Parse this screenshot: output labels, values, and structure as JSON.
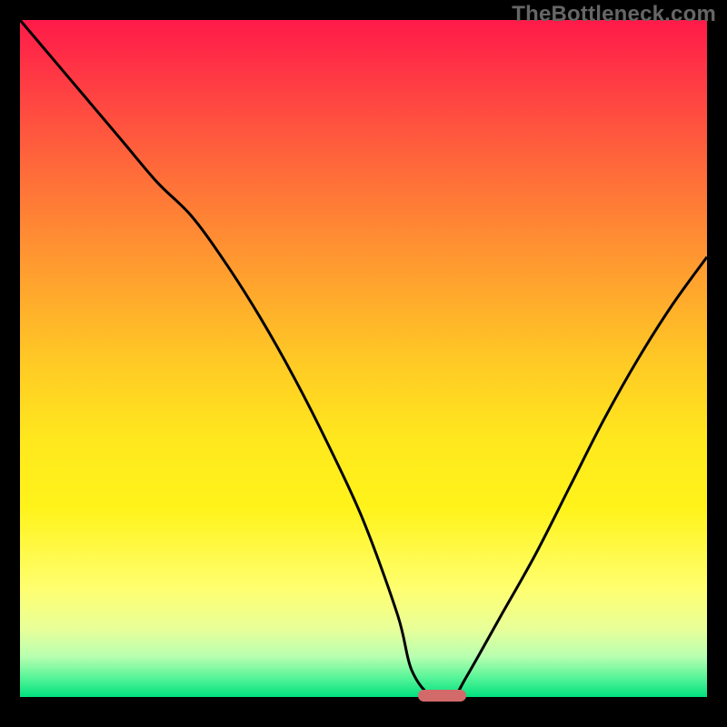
{
  "watermark": "TheBottleneck.com",
  "colors": {
    "frame": "#000000",
    "line": "#000000",
    "marker": "#d36a6a",
    "gradient_top": "#ff1a49",
    "gradient_bottom": "#00e07e"
  },
  "chart_data": {
    "type": "line",
    "title": "",
    "xlabel": "",
    "ylabel": "",
    "xlim": [
      0,
      100
    ],
    "ylim": [
      0,
      100
    ],
    "grid": false,
    "legend": false,
    "series": [
      {
        "name": "bottleneck-curve",
        "x": [
          0,
          5,
          10,
          15,
          20,
          25,
          30,
          35,
          40,
          45,
          50,
          55,
          57,
          60,
          63,
          65,
          70,
          75,
          80,
          85,
          90,
          95,
          100
        ],
        "y": [
          100,
          94,
          88,
          82,
          76,
          71,
          64,
          56,
          47,
          37,
          26,
          12,
          4,
          0,
          0,
          3,
          12,
          21,
          31,
          41,
          50,
          58,
          65
        ]
      }
    ],
    "marker": {
      "name": "optimal-range",
      "x_start": 58,
      "x_end": 65,
      "y": 0
    }
  }
}
